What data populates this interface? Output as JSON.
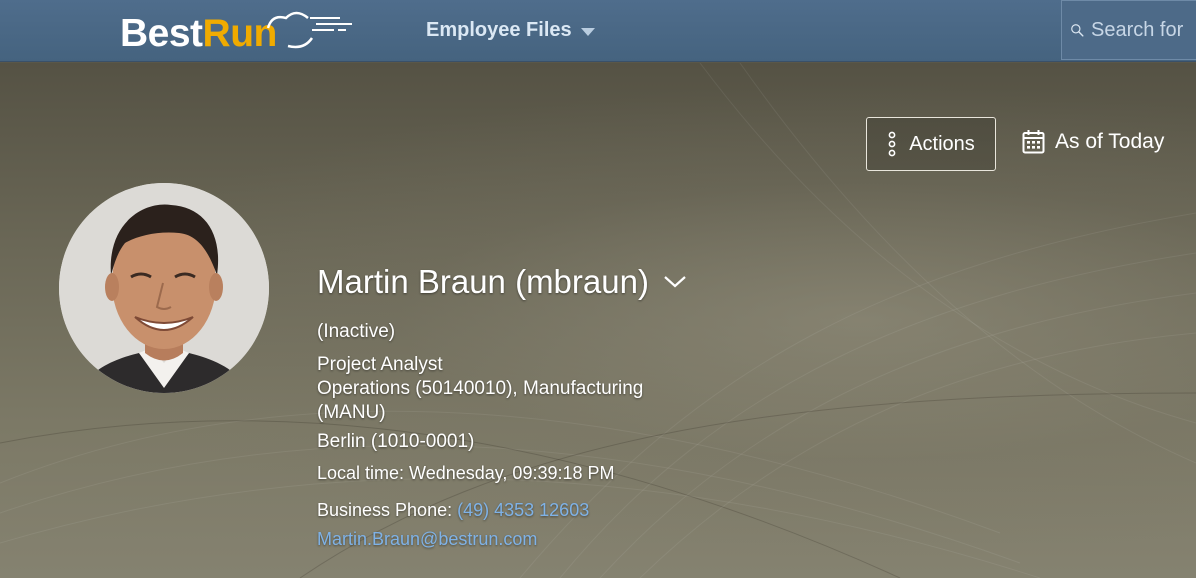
{
  "shell": {
    "logo": {
      "part1": "Best",
      "part2": "Run"
    },
    "module": {
      "label": "Employee Files"
    },
    "search": {
      "placeholder": "Search for"
    }
  },
  "header": {
    "actions_label": "Actions",
    "as_of_label": "As of Today"
  },
  "employee": {
    "name": "Martin Braun (mbraun)",
    "status": "(Inactive)",
    "job_title": "Project Analyst",
    "department_line1": "Operations (50140010), Manufacturing",
    "department_line2": "(MANU)",
    "location": "Berlin (1010-0001)",
    "local_time": "Local time: Wednesday, 09:39:18 PM",
    "phone_label": "Business Phone:",
    "phone": "(49) 4353 12603",
    "email": "Martin.Braun@bestrun.com"
  },
  "icons": {
    "search": "search-icon",
    "module_caret": "caret-down-icon",
    "actions": "more-vertical-icon",
    "calendar": "calendar-icon",
    "name_chevron": "chevron-down-icon"
  },
  "colors": {
    "shell_bar": "#4f6d8c",
    "brand_orange": "#f0ab00",
    "link": "#7fb2e6",
    "hero_bg": "#6a6756"
  }
}
